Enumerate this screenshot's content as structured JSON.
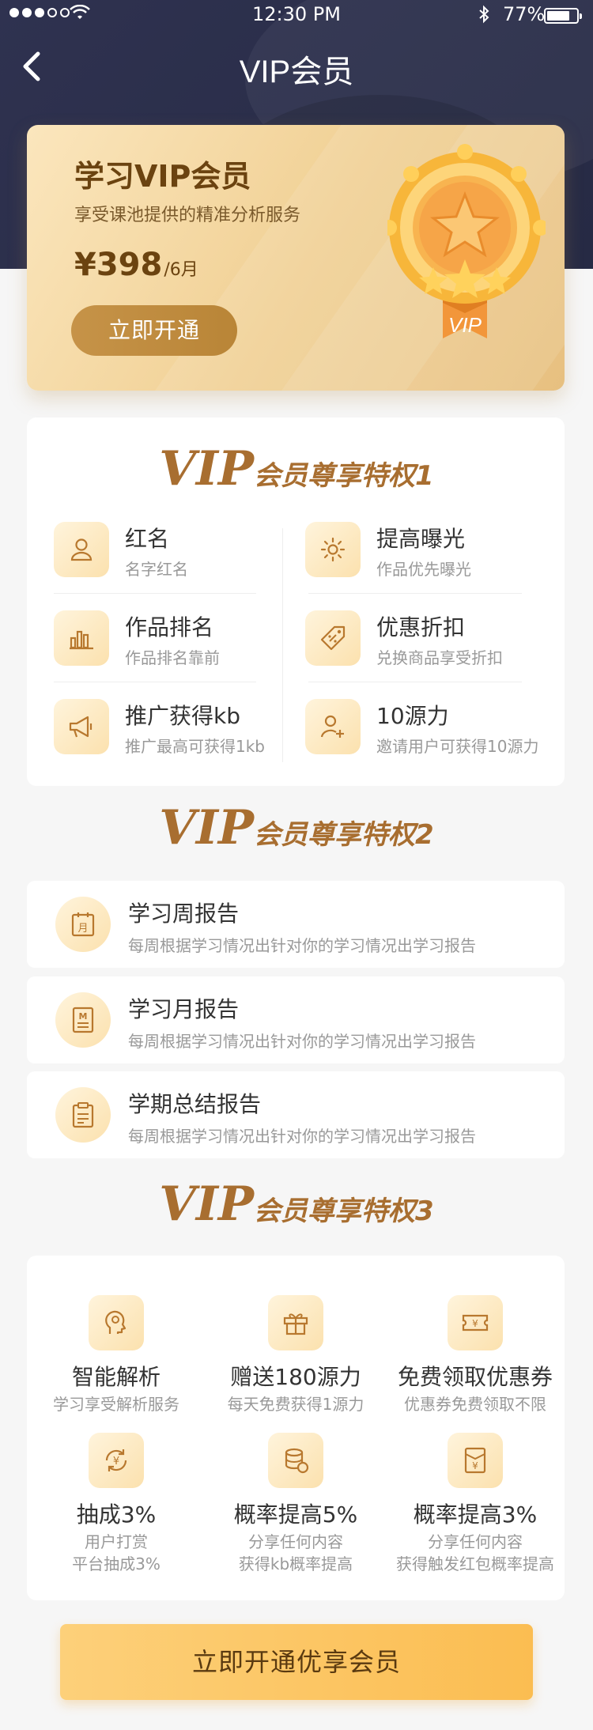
{
  "status_bar": {
    "time": "12:30 PM",
    "battery_percent": "77%",
    "battery_level": 0.77
  },
  "navbar": {
    "title": "VIP会员",
    "back_icon": "chevron-left-icon"
  },
  "vip_card": {
    "title": "学习VIP会员",
    "subtitle": "享受课池提供的精准分析服务",
    "price": "¥398",
    "period": "/6月",
    "button": "立即开通",
    "badge_text": "VIP"
  },
  "privilege1": {
    "heading_big": "VIP",
    "heading_small": "会员尊享特权1",
    "items": [
      {
        "title": "红名",
        "desc": "名字红名",
        "icon": "user-icon"
      },
      {
        "title": "提高曝光",
        "desc": "作品优先曝光",
        "icon": "sun-icon"
      },
      {
        "title": "作品排名",
        "desc": "作品排名靠前",
        "icon": "bar-chart-icon"
      },
      {
        "title": "优惠折扣",
        "desc": "兑换商品享受折扣",
        "icon": "tag-icon"
      },
      {
        "title": "推广获得kb",
        "desc": "推广最高可获得1kb",
        "icon": "megaphone-icon"
      },
      {
        "title": "10源力",
        "desc": "邀请用户可获得10源力",
        "icon": "user-add-icon"
      }
    ]
  },
  "privilege2": {
    "heading_big": "VIP",
    "heading_small": "会员尊享特权2",
    "items": [
      {
        "title": "学习周报告",
        "desc": "每周根据学习情况出针对你的学习情况出学习报告",
        "icon": "calendar-month-icon"
      },
      {
        "title": "学习月报告",
        "desc": "每周根据学习情况出针对你的学习情况出学习报告",
        "icon": "document-m-icon"
      },
      {
        "title": "学期总结报告",
        "desc": "每周根据学习情况出针对你的学习情况出学习报告",
        "icon": "clipboard-icon"
      }
    ]
  },
  "privilege3": {
    "heading_big": "VIP",
    "heading_small": "会员尊享特权3",
    "items": [
      {
        "title": "智能解析",
        "desc": "学习享受解析服务",
        "icon": "brain-head-icon"
      },
      {
        "title": "赠送180源力",
        "desc": "每天免费获得1源力",
        "icon": "gift-icon"
      },
      {
        "title": "免费领取优惠券",
        "desc": "优惠券免费领取不限",
        "icon": "coupon-icon"
      },
      {
        "title": "抽成3%",
        "desc": "用户打赏\n平台抽成3%",
        "icon": "yen-exchange-icon"
      },
      {
        "title": "概率提高5%",
        "desc": "分享任何内容\n获得kb概率提高",
        "icon": "coins-icon"
      },
      {
        "title": "概率提高3%",
        "desc": "分享任何内容\n获得触发红包概率提高",
        "icon": "red-envelope-icon"
      }
    ]
  },
  "cta_button": "立即开通优享会员"
}
